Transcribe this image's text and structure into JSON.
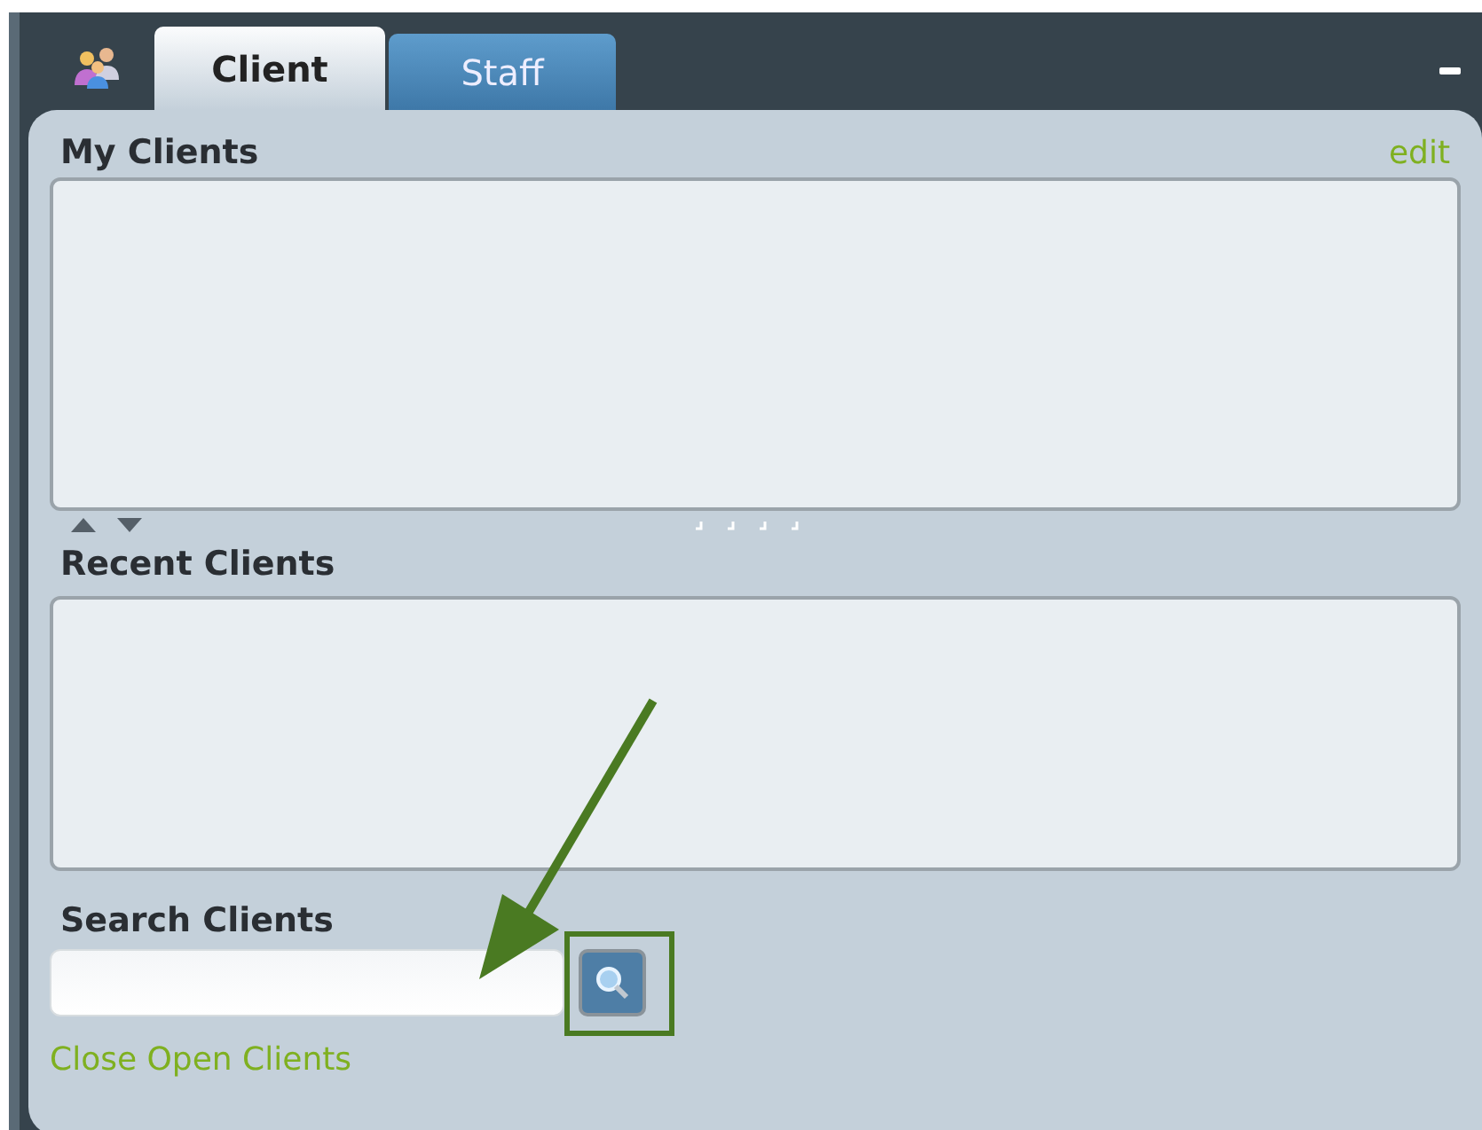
{
  "tabs": [
    {
      "label": "Client",
      "selected": true
    },
    {
      "label": "Staff",
      "selected": false
    }
  ],
  "my_clients": {
    "title": "My Clients",
    "edit_link": "edit"
  },
  "recent_clients": {
    "title": "Recent Clients"
  },
  "search": {
    "title": "Search Clients"
  },
  "close_link": "Close Open Clients"
}
